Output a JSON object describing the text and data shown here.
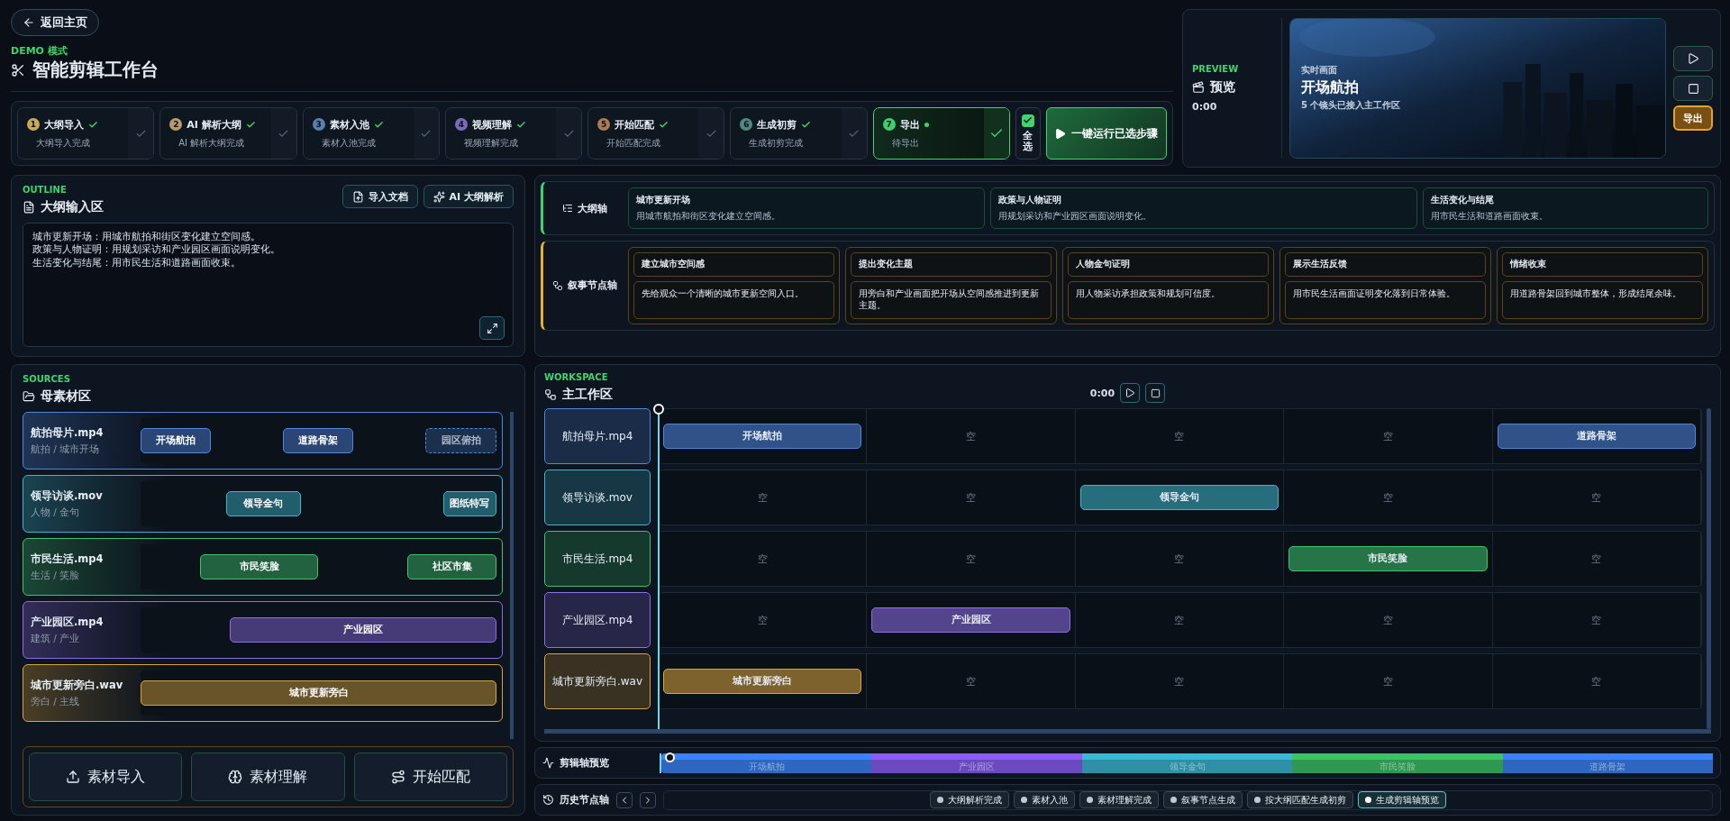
{
  "back_button": "返回主页",
  "mode_label": "DEMO 模式",
  "title": "智能剪辑工作台",
  "steps": [
    {
      "number": "1",
      "title": "大纲导入",
      "status": "大纲导入完成",
      "done": true,
      "selected": false,
      "color": "#c9a95a"
    },
    {
      "number": "2",
      "title": "AI 解析大纲",
      "status": "AI 解析大纲完成",
      "done": true,
      "selected": false,
      "color": "#b89a6a"
    },
    {
      "number": "3",
      "title": "素材入池",
      "status": "素材入池完成",
      "done": true,
      "selected": false,
      "color": "#5a7fb0"
    },
    {
      "number": "4",
      "title": "视频理解",
      "status": "视频理解完成",
      "done": true,
      "selected": false,
      "color": "#7a6ab8"
    },
    {
      "number": "5",
      "title": "开始匹配",
      "status": "开始匹配完成",
      "done": true,
      "selected": false,
      "color": "#b07a50"
    },
    {
      "number": "6",
      "title": "生成初剪",
      "status": "生成初剪完成",
      "done": true,
      "selected": false,
      "color": "#4f8a7a"
    },
    {
      "number": "7",
      "title": "导出",
      "status": "待导出",
      "done": false,
      "selected": true,
      "color": "#3fcf6a"
    }
  ],
  "select_all": {
    "label": "全选",
    "checked": true
  },
  "run_button": "一键运行已选步骤",
  "preview": {
    "section": "PREVIEW",
    "title": "预览",
    "time": "0:00",
    "caption": "实时画面",
    "clip_title": "开场航拍",
    "summary": "5 个镜头已接入主工作区",
    "export_button": "导出"
  },
  "outline": {
    "section": "OUTLINE",
    "title": "大纲输入区",
    "import_button": "导入文档",
    "ai_button": "AI 大纲解析",
    "lines": [
      "城市更新开场：用城市航拍和街区变化建立空间感。",
      "政策与人物证明：用规划采访和产业园区画面说明变化。",
      "生活变化与结尾：用市民生活和道路画面收束。"
    ]
  },
  "outline_axis": {
    "label": "大纲轴",
    "items": [
      {
        "title": "城市更新开场",
        "text": "用城市航拍和街区变化建立空间感。"
      },
      {
        "title": "政策与人物证明",
        "text": "用规划采访和产业园区画面说明变化。"
      },
      {
        "title": "生活变化与结尾",
        "text": "用市民生活和道路画面收束。"
      }
    ]
  },
  "story_axis": {
    "label": "叙事节点轴",
    "nodes": [
      {
        "title": "建立城市空间感",
        "text": "先给观众一个清晰的城市更新空间入口。"
      },
      {
        "title": "提出变化主题",
        "text": "用旁白和产业画面把开场从空间感推进到更新主题。"
      },
      {
        "title": "人物金句证明",
        "text": "用人物采访承担政策和规划可信度。"
      },
      {
        "title": "展示生活反馈",
        "text": "用市民生活画面证明变化落到日常体验。"
      },
      {
        "title": "情绪收束",
        "text": "用道路骨架回到城市整体，形成结尾余味。"
      }
    ]
  },
  "sources": {
    "section": "SOURCES",
    "title": "母素材区",
    "items": [
      {
        "name": "航拍母片.mp4",
        "tags": "航拍 / 城市开场",
        "color": "#4f86e0",
        "clips": [
          {
            "label": "开场航拍",
            "kind": "clip"
          },
          {
            "label": "道路骨架",
            "kind": "clip"
          },
          {
            "label": "园区俯拍",
            "kind": "ghost"
          }
        ]
      },
      {
        "name": "领导访谈.mov",
        "tags": "人物 / 金句",
        "color": "#3cb8cc",
        "clips": [
          {
            "label": "领导金句",
            "kind": "clip"
          },
          {
            "label": "图纸特写",
            "kind": "clip"
          }
        ]
      },
      {
        "name": "市民生活.mp4",
        "tags": "生活 / 笑脸",
        "color": "#3ec46c",
        "clips": [
          {
            "label": "市民笑脸",
            "kind": "clip"
          },
          {
            "label": "社区市集",
            "kind": "clip"
          }
        ]
      },
      {
        "name": "产业园区.mp4",
        "tags": "建筑 / 产业",
        "color": "#8e6ce6",
        "clips": [
          {
            "label": "产业园区",
            "kind": "clip"
          }
        ]
      },
      {
        "name": "城市更新旁白.wav",
        "tags": "旁白 / 主线",
        "color": "#dba43a",
        "clips": [
          {
            "label": "城市更新旁白",
            "kind": "clip"
          }
        ]
      }
    ],
    "buttons": [
      "素材导入",
      "素材理解",
      "开始匹配"
    ]
  },
  "workspace": {
    "section": "WORKSPACE",
    "title": "主工作区",
    "time": "0:00",
    "tracks": [
      {
        "name": "航拍母片.mp4",
        "color": "#4f86e0",
        "cells": [
          {
            "kind": "clip",
            "label": "开场航拍"
          },
          {
            "kind": "empty",
            "label": "空"
          },
          {
            "kind": "empty",
            "label": "空"
          },
          {
            "kind": "empty",
            "label": "空"
          },
          {
            "kind": "clip",
            "label": "道路骨架"
          }
        ]
      },
      {
        "name": "领导访谈.mov",
        "color": "#3cb8cc",
        "cells": [
          {
            "kind": "empty",
            "label": "空"
          },
          {
            "kind": "empty",
            "label": "空"
          },
          {
            "kind": "clip",
            "label": "领导金句"
          },
          {
            "kind": "empty",
            "label": "空"
          },
          {
            "kind": "empty",
            "label": "空"
          }
        ]
      },
      {
        "name": "市民生活.mp4",
        "color": "#3ec46c",
        "cells": [
          {
            "kind": "empty",
            "label": "空"
          },
          {
            "kind": "empty",
            "label": "空"
          },
          {
            "kind": "empty",
            "label": "空"
          },
          {
            "kind": "clip",
            "label": "市民笑脸"
          },
          {
            "kind": "empty",
            "label": "空"
          }
        ]
      },
      {
        "name": "产业园区.mp4",
        "color": "#8e6ce6",
        "cells": [
          {
            "kind": "empty",
            "label": "空"
          },
          {
            "kind": "clip",
            "label": "产业园区"
          },
          {
            "kind": "empty",
            "label": "空"
          },
          {
            "kind": "empty",
            "label": "空"
          },
          {
            "kind": "empty",
            "label": "空"
          }
        ]
      },
      {
        "name": "城市更新旁白.wav",
        "color": "#dba43a",
        "cells": [
          {
            "kind": "clip",
            "label": "城市更新旁白"
          },
          {
            "kind": "empty",
            "label": "空"
          },
          {
            "kind": "empty",
            "label": "空"
          },
          {
            "kind": "empty",
            "label": "空"
          },
          {
            "kind": "empty",
            "label": "空"
          }
        ]
      }
    ]
  },
  "clip_preview": {
    "label": "剪辑轴预览",
    "segments": [
      {
        "label": "开场航拍",
        "color": "#3b82f6"
      },
      {
        "label": "产业园区",
        "color": "#8b5cf6"
      },
      {
        "label": "领导金句",
        "color": "#3ab8d4"
      },
      {
        "label": "市民笑脸",
        "color": "#3cc464"
      },
      {
        "label": "道路骨架",
        "color": "#3b82f6"
      }
    ]
  },
  "history": {
    "label": "历史节点轴",
    "items": [
      {
        "label": "大纲解析完成",
        "selected": false
      },
      {
        "label": "素材入池",
        "selected": false
      },
      {
        "label": "素材理解完成",
        "selected": false
      },
      {
        "label": "叙事节点生成",
        "selected": false
      },
      {
        "label": "按大纲匹配生成初剪",
        "selected": false
      },
      {
        "label": "生成剪辑轴预览",
        "selected": true
      }
    ]
  }
}
